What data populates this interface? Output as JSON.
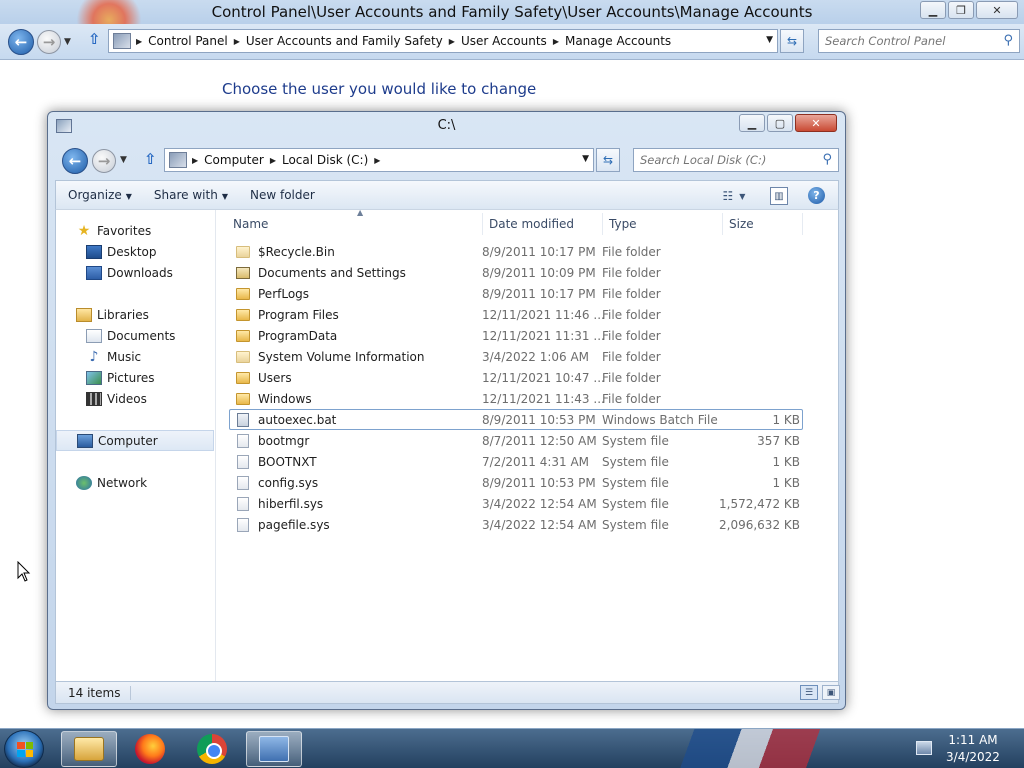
{
  "control_panel": {
    "title": "Control Panel\\User Accounts and Family Safety\\User Accounts\\Manage Accounts",
    "breadcrumbs": [
      "Control Panel",
      "User Accounts and Family Safety",
      "User Accounts",
      "Manage Accounts"
    ],
    "search_placeholder": "Search Control Panel",
    "heading": "Choose the user you would like to change"
  },
  "explorer": {
    "title": "C:\\",
    "breadcrumbs": [
      "Computer",
      "Local Disk (C:)"
    ],
    "search_placeholder": "Search Local Disk (C:)",
    "toolbar": {
      "organize": "Organize",
      "share_with": "Share with",
      "new_folder": "New folder"
    },
    "nav": {
      "favorites": "Favorites",
      "desktop": "Desktop",
      "downloads": "Downloads",
      "libraries": "Libraries",
      "documents": "Documents",
      "music": "Music",
      "pictures": "Pictures",
      "videos": "Videos",
      "computer": "Computer",
      "network": "Network"
    },
    "columns": {
      "name": "Name",
      "date_modified": "Date modified",
      "type": "Type",
      "size": "Size"
    },
    "files": [
      {
        "name": "$Recycle.Bin",
        "date": "8/9/2011 10:17 PM",
        "type": "File folder",
        "size": "",
        "icon": "folder-system"
      },
      {
        "name": "Documents and Settings",
        "date": "8/9/2011 10:09 PM",
        "type": "File folder",
        "size": "",
        "icon": "folder-link"
      },
      {
        "name": "PerfLogs",
        "date": "8/9/2011 10:17 PM",
        "type": "File folder",
        "size": "",
        "icon": "folder"
      },
      {
        "name": "Program Files",
        "date": "12/11/2021 11:46 ...",
        "type": "File folder",
        "size": "",
        "icon": "folder"
      },
      {
        "name": "ProgramData",
        "date": "12/11/2021 11:31 ...",
        "type": "File folder",
        "size": "",
        "icon": "folder"
      },
      {
        "name": "System Volume Information",
        "date": "3/4/2022 1:06 AM",
        "type": "File folder",
        "size": "",
        "icon": "folder-system"
      },
      {
        "name": "Users",
        "date": "12/11/2021 10:47 ...",
        "type": "File folder",
        "size": "",
        "icon": "folder"
      },
      {
        "name": "Windows",
        "date": "12/11/2021 11:43 ...",
        "type": "File folder",
        "size": "",
        "icon": "folder"
      },
      {
        "name": "autoexec.bat",
        "date": "8/9/2011 10:53 PM",
        "type": "Windows Batch File",
        "size": "1 KB",
        "icon": "bat"
      },
      {
        "name": "bootmgr",
        "date": "8/7/2011 12:50 AM",
        "type": "System file",
        "size": "357 KB",
        "icon": "file"
      },
      {
        "name": "BOOTNXT",
        "date": "7/2/2011 4:31 AM",
        "type": "System file",
        "size": "1 KB",
        "icon": "file"
      },
      {
        "name": "config.sys",
        "date": "8/9/2011 10:53 PM",
        "type": "System file",
        "size": "1 KB",
        "icon": "file"
      },
      {
        "name": "hiberfil.sys",
        "date": "3/4/2022 12:54 AM",
        "type": "System file",
        "size": "1,572,472 KB",
        "icon": "file"
      },
      {
        "name": "pagefile.sys",
        "date": "3/4/2022 12:54 AM",
        "type": "System file",
        "size": "2,096,632 KB",
        "icon": "file"
      }
    ],
    "selected_file": "autoexec.bat",
    "status": "14 items"
  },
  "taskbar": {
    "apps": [
      "windows-explorer",
      "firefox",
      "chrome",
      "control-panel"
    ],
    "time": "1:11 AM",
    "date": "3/4/2022"
  }
}
